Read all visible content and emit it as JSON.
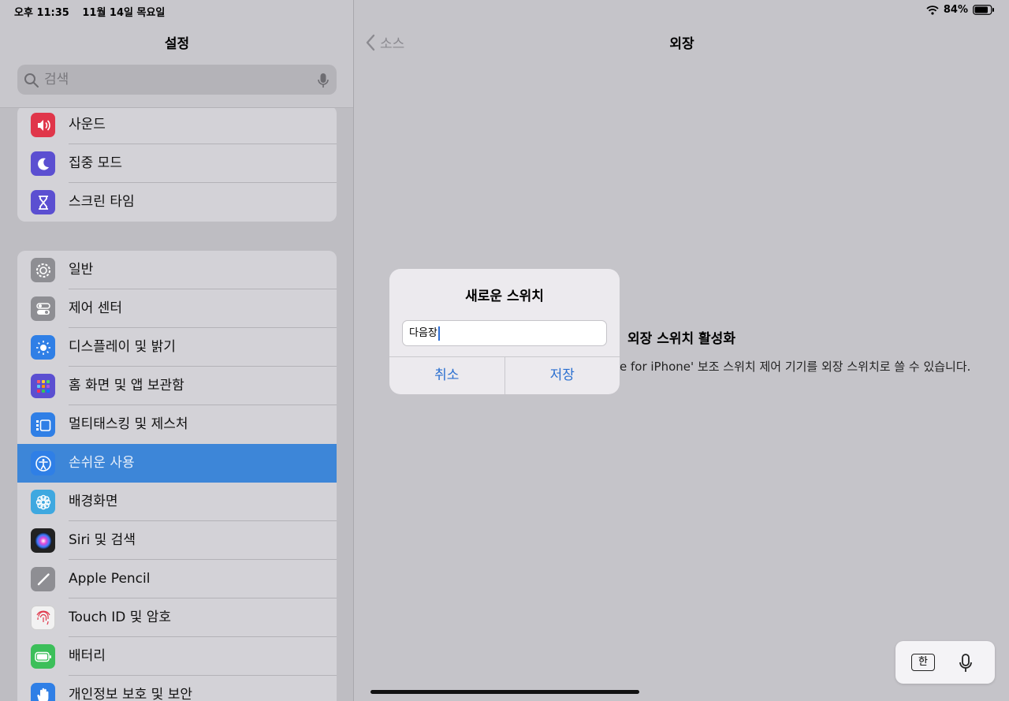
{
  "status": {
    "time": "오후 11:35",
    "date": "11월 14일 목요일",
    "battery": "84%"
  },
  "sidebar": {
    "title": "설정",
    "search_placeholder": "검색",
    "group1": [
      {
        "label": "사운드",
        "icon": "speaker-icon",
        "color": "#e0364a"
      },
      {
        "label": "집중 모드",
        "icon": "moon-icon",
        "color": "#5b4fd1"
      },
      {
        "label": "스크린 타임",
        "icon": "hourglass-icon",
        "color": "#5b4fd1"
      }
    ],
    "group2": [
      {
        "label": "일반",
        "icon": "gear-icon",
        "color": "#8e8e93"
      },
      {
        "label": "제어 센터",
        "icon": "toggles-icon",
        "color": "#8e8e93"
      },
      {
        "label": "디스플레이 및 밝기",
        "icon": "sun-icon",
        "color": "#2f7fe6"
      },
      {
        "label": "홈 화면 및 앱 보관함",
        "icon": "grid-icon",
        "color": "#5b4fd1"
      },
      {
        "label": "멀티태스킹 및 제스처",
        "icon": "multitask-icon",
        "color": "#2f7fe6"
      },
      {
        "label": "손쉬운 사용",
        "icon": "accessibility-icon",
        "color": "#2f7fe6"
      },
      {
        "label": "배경화면",
        "icon": "flower-icon",
        "color": "#3ea8e0"
      },
      {
        "label": "Siri 및 검색",
        "icon": "siri-icon",
        "color": "#222"
      },
      {
        "label": "Apple Pencil",
        "icon": "pencil-icon",
        "color": "#8e8e93"
      },
      {
        "label": "Touch ID 및 암호",
        "icon": "fingerprint-icon",
        "color": "#f2f2f2"
      },
      {
        "label": "배터리",
        "icon": "battery-icon",
        "color": "#3cbf5a"
      },
      {
        "label": "개인정보 보호 및 보안",
        "icon": "hand-icon",
        "color": "#2f7fe6"
      }
    ],
    "selected_index": 5
  },
  "detail": {
    "back_label": "소스",
    "title": "외장",
    "empty_title": "외장 스위치 활성화",
    "empty_desc": "e for iPhone' 보조 스위치 제어 기기를 외장 스위치로 쓸 수 있습니다."
  },
  "alert": {
    "title": "새로운 스위치",
    "field_value": "다음장",
    "cancel_label": "취소",
    "save_label": "저장"
  },
  "keyboard": {
    "lang_key": "한"
  }
}
